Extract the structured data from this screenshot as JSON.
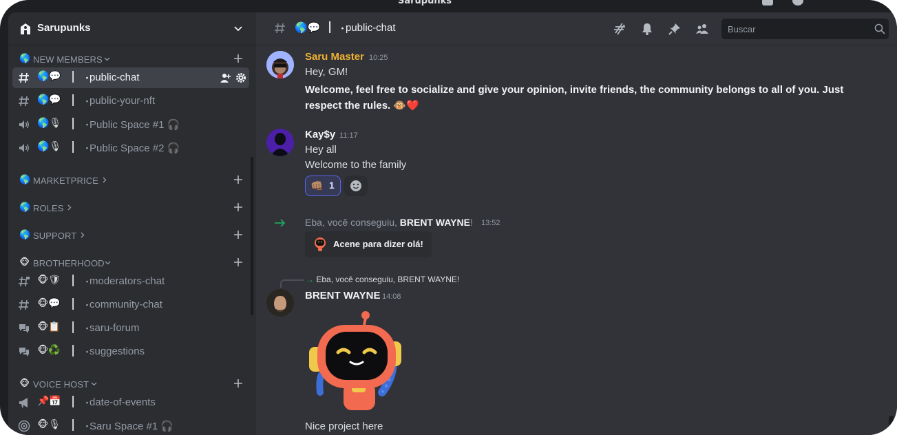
{
  "app": {
    "title": "Sarupunks"
  },
  "server": {
    "name": "Sarupunks"
  },
  "sidebar": {
    "categories": [
      {
        "emoji": "🌎",
        "label": "NEW MEMBERS"
      },
      {
        "emoji": "🌎",
        "label": "MARKETPRICE"
      },
      {
        "emoji": "🌎",
        "label": "ROLES"
      },
      {
        "emoji": "🌎",
        "label": "SUPPORT"
      },
      {
        "emoji": "🐵",
        "label": "BROTHERHOOD"
      },
      {
        "emoji": "🐵",
        "label": "VOICE HOST"
      }
    ],
    "channels": [
      {
        "emojis": "🌎💬",
        "sep": "|",
        "dot": "・",
        "name": "public-chat"
      },
      {
        "emojis": "🌎💬",
        "sep": "|",
        "dot": "・",
        "name": "public-your-nft"
      },
      {
        "emojis": "🌎🎙",
        "sep": "|",
        "dot": "・",
        "name": "Public Space #1 🎧"
      },
      {
        "emojis": "🌎🎙",
        "sep": "|",
        "dot": "・",
        "name": "Public Space #2 🎧"
      },
      {
        "emojis": "🐵🛡",
        "sep": "|",
        "dot": "・",
        "name": "moderators-chat"
      },
      {
        "emojis": "🐵💬",
        "sep": "|",
        "dot": "・",
        "name": "community-chat"
      },
      {
        "emojis": "🐵📋",
        "sep": "|",
        "dot": "・",
        "name": "saru-forum"
      },
      {
        "emojis": "🐵♻️",
        "sep": "|",
        "dot": "・",
        "name": "suggestions"
      },
      {
        "emojis": "📌📅",
        "sep": "|",
        "dot": "・",
        "name": "date-of-events"
      },
      {
        "emojis": "🐵🎙",
        "sep": "|",
        "dot": "・",
        "name": " Saru Space #1 🎧"
      }
    ]
  },
  "header": {
    "emojis": "🌎💬",
    "sep": "|",
    "dot": "・",
    "channel": "public-chat",
    "search_placeholder": "Buscar"
  },
  "messages": {
    "m1": {
      "author": "Saru Master",
      "author_color": "#f0b232",
      "time": "10:25",
      "line1": "Hey, GM!",
      "line2": "Welcome, feel free to socialize and give your opinion, invite friends, the community belongs to all of you. Just",
      "line3": "respect the rules. 🐵❤️"
    },
    "m2": {
      "author": "Kay$y",
      "time": "11:17",
      "line1": "Hey all",
      "line2": "Welcome to the family",
      "reaction_emoji": "👊🏽",
      "reaction_count": "1"
    },
    "join": {
      "text": "Eba, você conseguiu, ",
      "name": "BRENT WAYNE",
      "suffix": "!",
      "time": "13:52",
      "wave_label": "Acene para dizer olá!"
    },
    "m3": {
      "reply": "Eba, você conseguiu, BRENT WAYNE!",
      "author": "BRENT WAYNE",
      "time": "14:08",
      "line1": "Nice project here"
    }
  },
  "colors": {
    "accent": "#5865f2",
    "join_arrow": "#23a55a"
  }
}
